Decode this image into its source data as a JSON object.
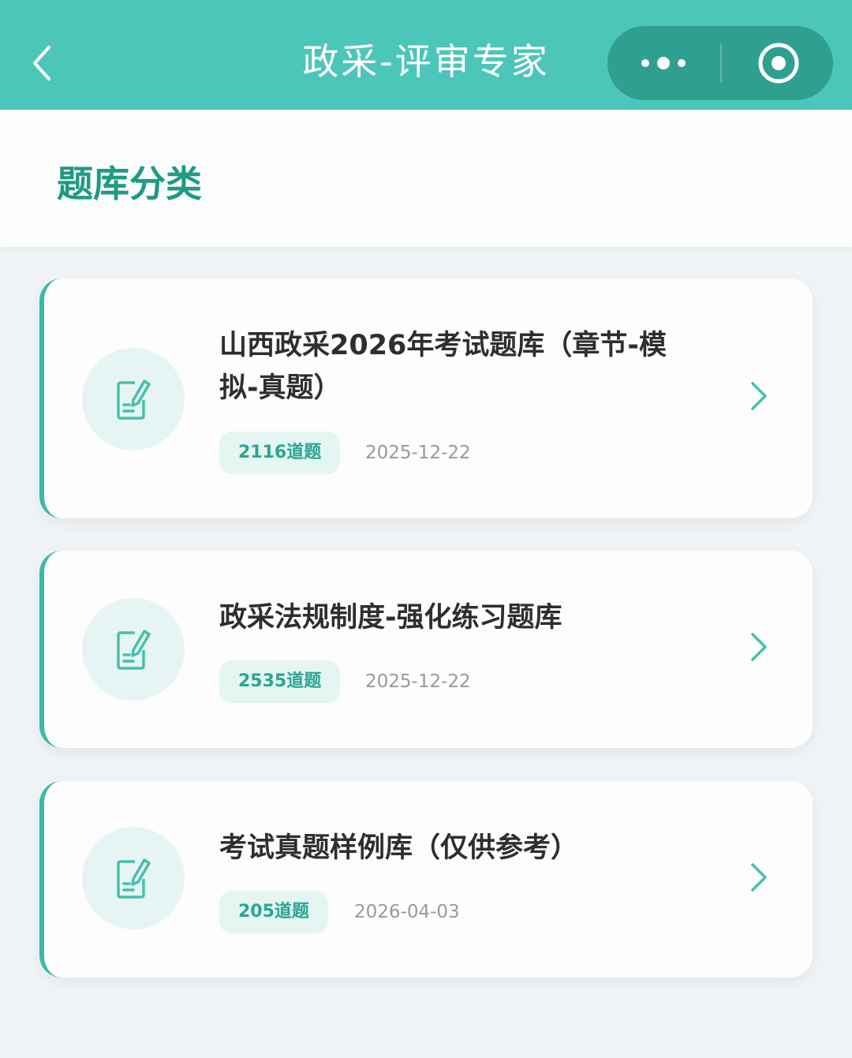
{
  "navbar": {
    "title": "政采-评审专家",
    "back_icon": "chevron-left-icon",
    "more_icon": "more-dots-icon",
    "close_icon": "target-circle-icon",
    "color": "#4cc6b9",
    "capsule_color": "#2f9f90"
  },
  "section": {
    "title": "题库分类",
    "title_color": "#1f9a83"
  },
  "cards": [
    {
      "title_line1": "山西政采2026年考试题库（章节-模",
      "title_line2": "拟-真题）",
      "badge": "2116道题",
      "date": "2025-12-22",
      "icon": "edit-document-icon"
    },
    {
      "title_line1": "政采法规制度-强化练习题库",
      "badge": "2535道题",
      "date": "2025-12-22",
      "icon": "edit-document-icon"
    },
    {
      "title_line1": "考试真题样例库（仅供参考）",
      "badge": "205道题",
      "date": "2026-04-03",
      "icon": "edit-document-icon"
    }
  ],
  "colors": {
    "accent": "#3cb9a5",
    "badge_bg": "#e4f5f2",
    "badge_text": "#2aa590",
    "background": "#f1f4f6"
  }
}
